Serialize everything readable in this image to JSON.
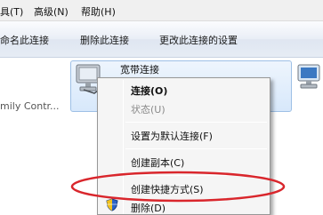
{
  "menubar": {
    "items": [
      "具(T)",
      "高级(N)",
      "帮助(H)"
    ]
  },
  "toolbar": {
    "rename_label": "命名此连接",
    "delete_label": "删除此连接",
    "change_settings_label": "更改此连接的设置"
  },
  "content": {
    "left_tile_text": "mily Contr...",
    "connection_title": "宽带连接"
  },
  "context_menu": {
    "items": [
      {
        "label": "连接(O)",
        "style": "bold"
      },
      {
        "label": "状态(U)",
        "style": "disabled"
      },
      {
        "label": "设置为默认连接(F)",
        "style": "normal"
      },
      {
        "label": "创建副本(C)",
        "style": "normal"
      },
      {
        "label": "创建快捷方式(S)",
        "style": "normal"
      },
      {
        "label": "删除(D)",
        "style": "normal"
      }
    ]
  },
  "colors": {
    "highlight": "#d9262c",
    "selection_tile": "#d7e8fb",
    "menu_bg": "#f5f5f5"
  }
}
